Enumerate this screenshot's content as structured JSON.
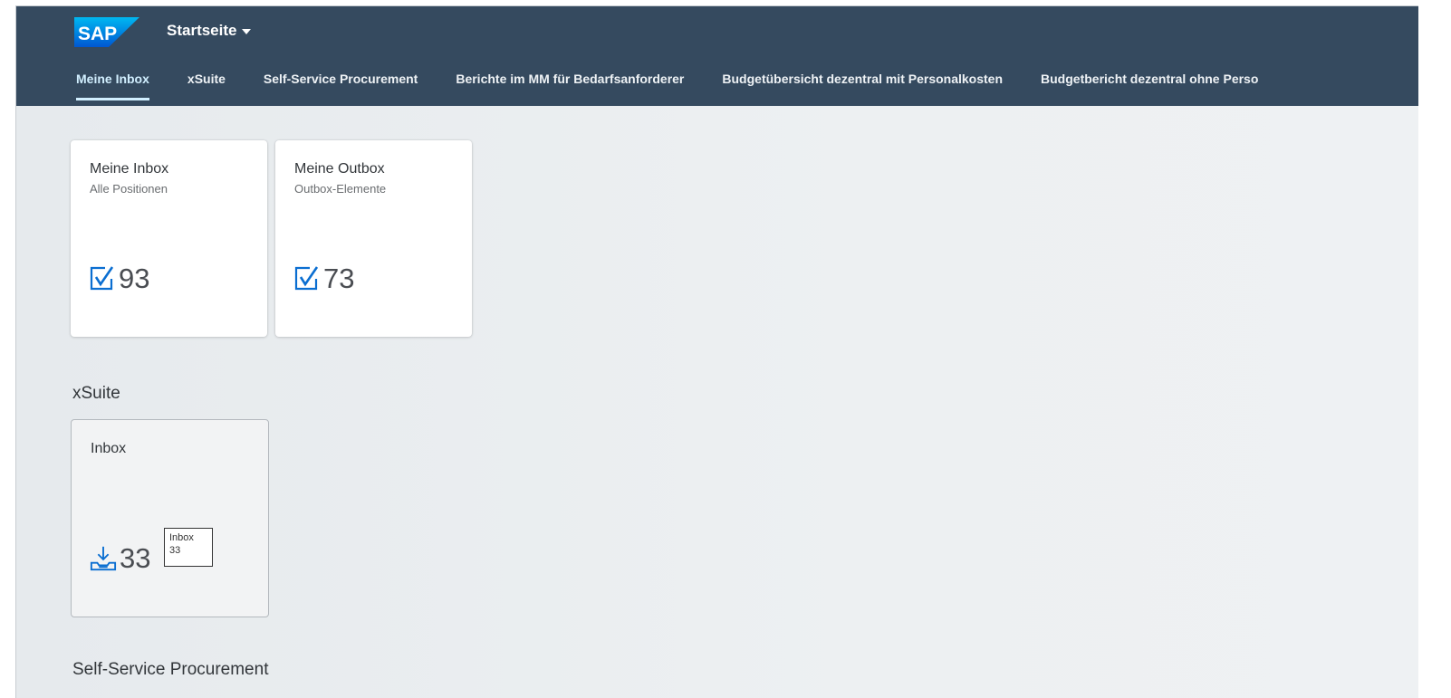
{
  "shell": {
    "logo_text": "SAP",
    "app_title": "Startseite",
    "colors": {
      "header_bg": "#354a5f",
      "active_tab": "#d1efff",
      "logo_blue": "#0a6ed1"
    }
  },
  "tabs": [
    {
      "label": "Meine Inbox",
      "active": true
    },
    {
      "label": "xSuite",
      "active": false
    },
    {
      "label": "Self-Service Procurement",
      "active": false
    },
    {
      "label": "Berichte im MM für Bedarfsanforderer",
      "active": false
    },
    {
      "label": "Budgetübersicht dezentral mit Personalkosten",
      "active": false
    },
    {
      "label": "Budgetbericht dezentral ohne Perso",
      "active": false
    }
  ],
  "tiles": {
    "inbox": {
      "title": "Meine Inbox",
      "subtitle": "Alle Positionen",
      "value": "93",
      "icon": "task-checkbox-icon"
    },
    "outbox": {
      "title": "Meine Outbox",
      "subtitle": "Outbox-Elemente",
      "value": "73",
      "icon": "task-checkbox-icon"
    },
    "xsuite_inbox": {
      "title": "Inbox",
      "value": "33",
      "icon": "inbox-download-icon"
    }
  },
  "sections": {
    "xsuite": "xSuite",
    "self_service": "Self-Service Procurement"
  },
  "tooltip": {
    "line1": "Inbox",
    "line2": "33"
  }
}
